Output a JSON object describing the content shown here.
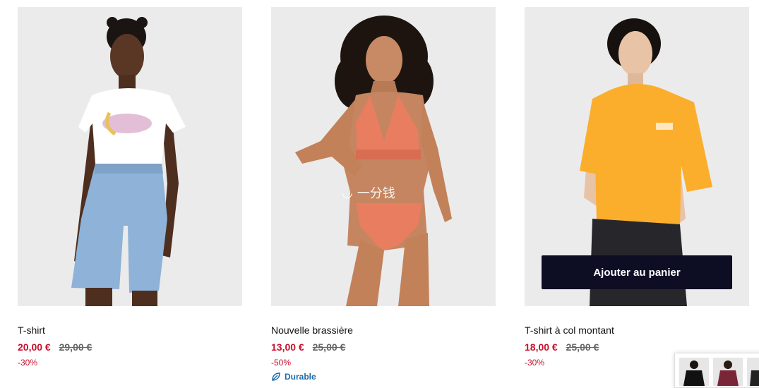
{
  "products": [
    {
      "title": "T-shirt",
      "price_new": "20,00 €",
      "price_old": "29,00 €",
      "discount": "-30%",
      "image_icon": "model-tshirt-denim-shorts"
    },
    {
      "title": "Nouvelle brassière",
      "price_new": "13,00 €",
      "price_old": "25,00 €",
      "discount": "-50%",
      "badge": "Durable",
      "badge_icon": "leaf-icon",
      "image_icon": "model-bralette-set",
      "watermark": "一分钱"
    },
    {
      "title": "T-shirt à col montant",
      "price_new": "18,00 €",
      "price_old": "25,00 €",
      "discount": "-30%",
      "add_to_cart_label": "Ajouter au panier",
      "image_icon": "model-yellow-tee-black-jeans"
    }
  ],
  "colors": {
    "sale_red": "#c8102e",
    "button_navy": "#0d0d24",
    "badge_blue": "#1e6aa8"
  }
}
